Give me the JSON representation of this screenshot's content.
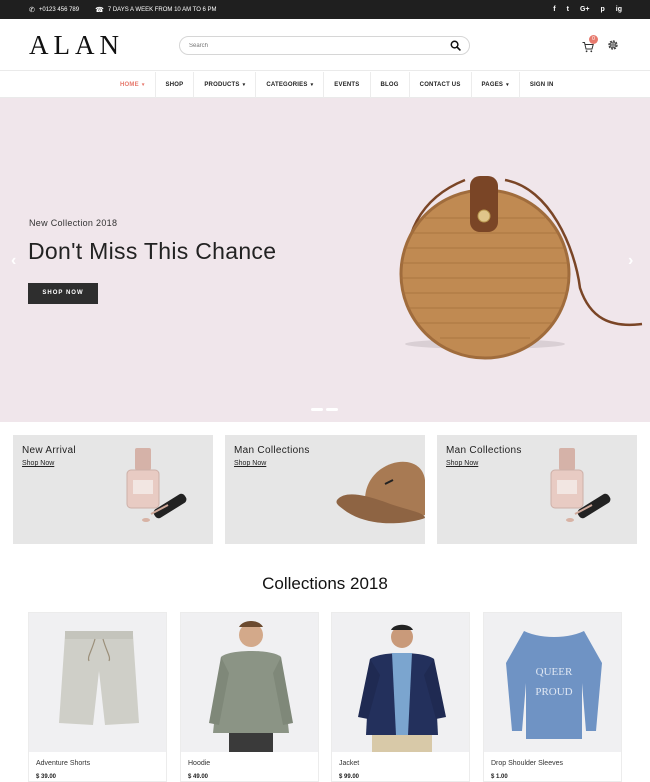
{
  "topbar": {
    "phone": "+0123 456 789",
    "hours": "7 DAYS A WEEK FROM 10 AM TO 6 PM",
    "social": [
      "f",
      "t",
      "G+",
      "p",
      "ig"
    ]
  },
  "header": {
    "logo": "ALAN",
    "search_placeholder": "Search",
    "cart_count": "0"
  },
  "nav": {
    "items": [
      {
        "label": "HOME",
        "caret": "▾"
      },
      {
        "label": "SHOP"
      },
      {
        "label": "PRODUCTS",
        "caret": "▾"
      },
      {
        "label": "CATEGORIES",
        "caret": "▾"
      },
      {
        "label": "EVENTS"
      },
      {
        "label": "BLOG"
      },
      {
        "label": "CONTACT US"
      },
      {
        "label": "PAGES",
        "caret": "▾"
      },
      {
        "label": "SIGN IN"
      }
    ]
  },
  "hero": {
    "subtitle": "New Collection 2018",
    "title": "Don't Miss This Chance",
    "button": "SHOP NOW",
    "prev": "‹",
    "next": "›"
  },
  "banners": [
    {
      "title": "New Arrival",
      "link": "Shop Now"
    },
    {
      "title": "Man Collections",
      "link": "Shop Now"
    },
    {
      "title": "Man Collections",
      "link": "Shop Now"
    }
  ],
  "collections": {
    "title": "Collections 2018",
    "products": [
      {
        "name": "Adventure Shorts",
        "price": "$ 39.00"
      },
      {
        "name": "Hoodie",
        "price": "$ 49.00"
      },
      {
        "name": "Jacket",
        "price": "$ 99.00"
      },
      {
        "name": "Drop Shoulder Sleeves",
        "price": "$ 1.00"
      }
    ]
  },
  "colors": {
    "accent": "#e77a6e",
    "topbar": "#1f1f1f",
    "hero_bg": "#f0e6eb",
    "banner_bg": "#e6e6e6"
  }
}
